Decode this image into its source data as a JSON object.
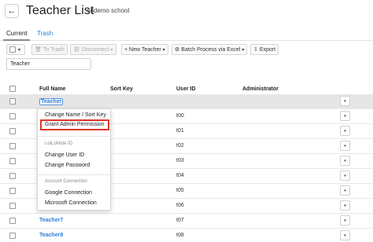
{
  "header": {
    "title": "Teacher List",
    "school": "endemo school",
    "back_icon": "←"
  },
  "tabs": {
    "current": "Current",
    "trash": "Trash"
  },
  "toolbar": {
    "to_trash": "To Trash",
    "disconnect": "Disconnect",
    "new_teacher": "+ New Teacher",
    "batch_process": "Batch Process via Excel",
    "export": "Export",
    "chevron": "▾"
  },
  "search": {
    "value": "Teacher"
  },
  "table": {
    "columns": {
      "full_name": "Full Name",
      "sort_key": "Sort Key",
      "user_id": "User ID",
      "administrator": "Administrator"
    },
    "rows": [
      {
        "name": "Teacher",
        "user_id": ""
      },
      {
        "name": "",
        "user_id": "t00"
      },
      {
        "name": "",
        "user_id": "t01"
      },
      {
        "name": "",
        "user_id": "t02"
      },
      {
        "name": "",
        "user_id": "t03"
      },
      {
        "name": "",
        "user_id": "t04"
      },
      {
        "name": "",
        "user_id": "t05"
      },
      {
        "name": "",
        "user_id": "t06"
      },
      {
        "name": "Teacher7",
        "user_id": "t07"
      },
      {
        "name": "Teacher8",
        "user_id": "t08"
      }
    ]
  },
  "context_menu": {
    "change_name": "Change Name / Sort Key",
    "grant_admin": "Grant Admin Permission",
    "loilonote_header": "LoiLoNote ID",
    "change_user_id": "Change User ID",
    "change_password": "Change Password",
    "account_header": "Account Connection",
    "google": "Google Connection",
    "microsoft": "Microsoft Connection"
  },
  "colors": {
    "link": "#2a7fd4",
    "highlight": "#e0362a"
  }
}
